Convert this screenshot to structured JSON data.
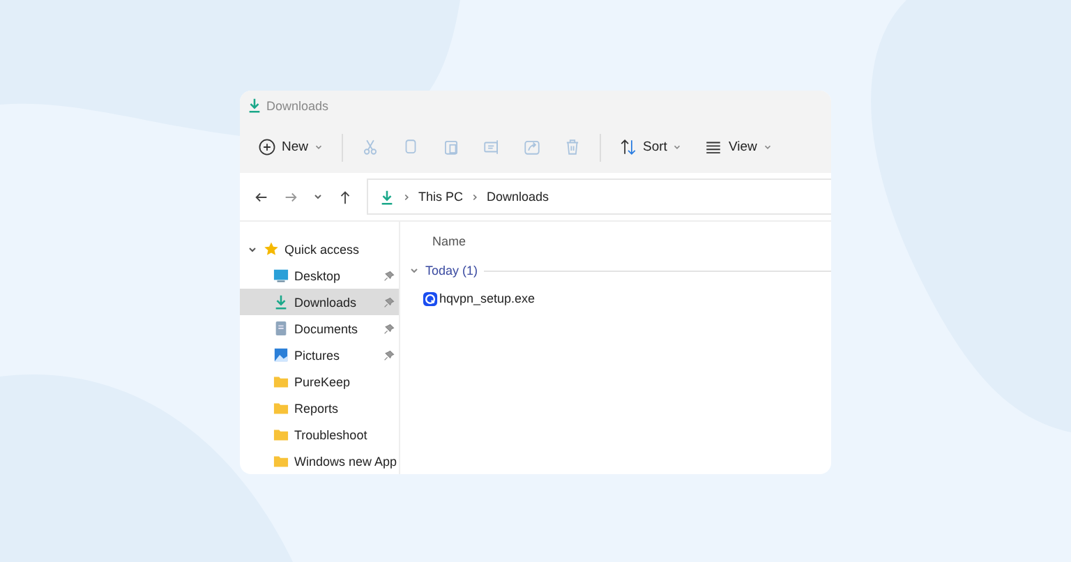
{
  "window": {
    "title": "Downloads"
  },
  "toolbar": [
    {
      "kind": "new",
      "label": "New",
      "disabled": false,
      "dropdown": true
    },
    {
      "kind": "cut",
      "disabled": true
    },
    {
      "kind": "copy",
      "disabled": true
    },
    {
      "kind": "paste",
      "disabled": true
    },
    {
      "kind": "rename",
      "disabled": true
    },
    {
      "kind": "share",
      "disabled": true
    },
    {
      "kind": "delete",
      "disabled": true
    },
    {
      "kind": "sort",
      "label": "Sort",
      "disabled": false,
      "dropdown": true
    },
    {
      "kind": "view",
      "label": "View",
      "disabled": false,
      "dropdown": true
    }
  ],
  "address_bar": {
    "path": [
      "This PC",
      "Downloads"
    ]
  },
  "sidebar": {
    "group": {
      "label": "Quick access",
      "expanded": true
    },
    "items": [
      {
        "kind": "desktop",
        "label": "Desktop",
        "pinned": true,
        "selected": false
      },
      {
        "kind": "downloads",
        "label": "Downloads",
        "pinned": true,
        "selected": true
      },
      {
        "kind": "documents",
        "label": "Documents",
        "pinned": true,
        "selected": false
      },
      {
        "kind": "pictures",
        "label": "Pictures",
        "pinned": true,
        "selected": false
      },
      {
        "kind": "folder",
        "label": "PureKeep",
        "pinned": false,
        "selected": false
      },
      {
        "kind": "folder",
        "label": "Reports",
        "pinned": false,
        "selected": false
      },
      {
        "kind": "folder",
        "label": "Troubleshoot",
        "pinned": false,
        "selected": false
      },
      {
        "kind": "folder",
        "label": "Windows new App",
        "pinned": false,
        "selected": false
      }
    ]
  },
  "file_list": {
    "columns": [
      "Name"
    ],
    "groups": [
      {
        "label": "Today (1)",
        "expanded": true,
        "files": [
          {
            "name": "hqvpn_setup.exe"
          }
        ]
      }
    ]
  }
}
